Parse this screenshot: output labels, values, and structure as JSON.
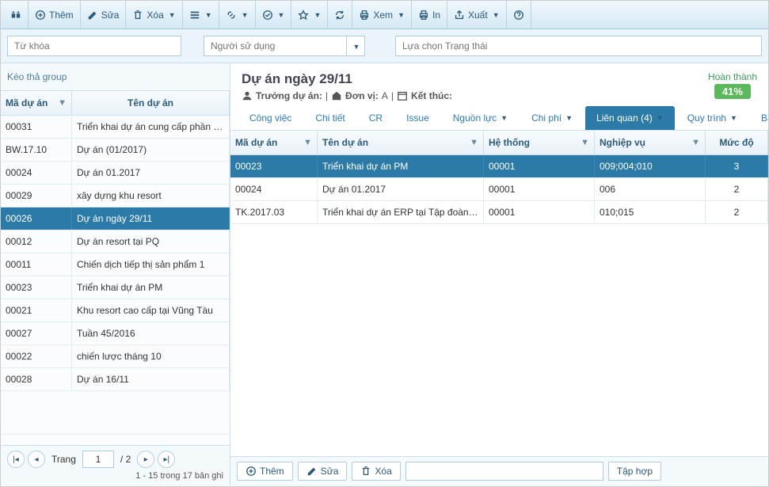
{
  "toolbar": {
    "add": "Thêm",
    "edit": "Sửa",
    "delete": "Xóa",
    "view": "Xem",
    "print": "In",
    "export": "Xuất"
  },
  "filters": {
    "keyword_placeholder": "Từ khóa",
    "user_placeholder": "Người sử dụng",
    "status_placeholder": "Lựa chọn Trạng thái"
  },
  "left": {
    "group_hint": "Kéo thả group",
    "cols": {
      "code": "Mã dự án",
      "name": "Tên dự án"
    },
    "rows": [
      {
        "code": "00031",
        "name": "Triển khai dự án cung cấp phần mềm quen"
      },
      {
        "code": "BW.17.10",
        "name": "Dự án (01/2017)"
      },
      {
        "code": "00024",
        "name": "Dự án 01.2017"
      },
      {
        "code": "00029",
        "name": "xây dựng khu resort"
      },
      {
        "code": "00026",
        "name": "Dự án ngày 29/11",
        "selected": true
      },
      {
        "code": "00012",
        "name": "Dự án resort tại PQ"
      },
      {
        "code": "00011",
        "name": "Chiến dịch tiếp thị sản phẩm 1"
      },
      {
        "code": "00023",
        "name": "Triển khai dự án PM"
      },
      {
        "code": "00021",
        "name": "Khu resort cao cấp tại Vũng Tàu"
      },
      {
        "code": "00027",
        "name": "Tuần 45/2016"
      },
      {
        "code": "00022",
        "name": "chiến lược tháng 10"
      },
      {
        "code": "00028",
        "name": "Dự án 16/11"
      }
    ],
    "pager": {
      "label": "Trang",
      "page": "1",
      "total": "/ 2",
      "info": "1 - 15 trong 17 bản ghi"
    }
  },
  "detail": {
    "title": "Dự án ngày 29/11",
    "manager_label": "Trưởng dự án:",
    "unit_label": "Đơn vị:",
    "unit_value": "A",
    "end_label": "Kết thúc:",
    "progress_label": "Hoàn thành",
    "progress_value": "41%",
    "tabs": [
      {
        "label": "Công việc"
      },
      {
        "label": "Chi tiết"
      },
      {
        "label": "CR"
      },
      {
        "label": "Issue"
      },
      {
        "label": "Nguồn lực",
        "dropdown": true
      },
      {
        "label": "Chi phí",
        "dropdown": true
      },
      {
        "label": "Liên quan (4)",
        "dropdown": true,
        "active": true
      },
      {
        "label": "Quy trình",
        "dropdown": true
      },
      {
        "label": "Báo cáo",
        "dropdown": true
      }
    ],
    "cols": {
      "code": "Mã dự án",
      "name": "Tên dự án",
      "system": "Hệ thống",
      "biz": "Nghiệp vụ",
      "level": "Mức độ"
    },
    "rows": [
      {
        "code": "00023",
        "name": "Triển khai dự án PM",
        "system": "00001",
        "biz": "009;004;010",
        "level": "3",
        "selected": true
      },
      {
        "code": "00024",
        "name": "Dự án 01.2017",
        "system": "00001",
        "biz": "006",
        "level": "2"
      },
      {
        "code": "TK.2017.03",
        "name": "Triển khai dự án ERP tại Tập đoàn ASK",
        "system": "00001",
        "biz": "010;015",
        "level": "2"
      }
    ]
  },
  "bottom": {
    "add": "Thêm",
    "edit": "Sửa",
    "delete": "Xóa",
    "group": "Tập hợp"
  }
}
